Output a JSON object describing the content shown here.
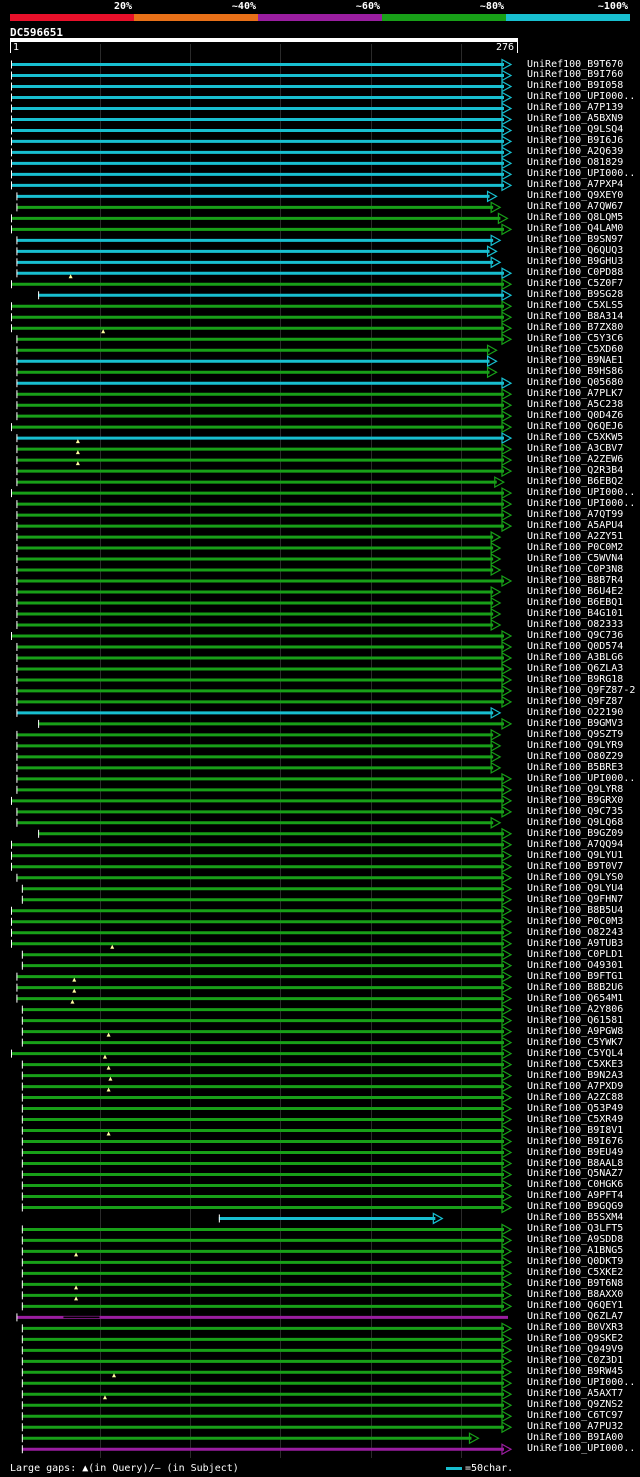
{
  "legend": {
    "labels": [
      "20%",
      "~40%",
      "~60%",
      "~80%",
      "~100%"
    ],
    "colors": [
      "#e8102a",
      "#e87018",
      "#9a1ea0",
      "#18a018",
      "#18bfd0"
    ]
  },
  "query": {
    "id": "DC596651",
    "start": "1",
    "end": "276"
  },
  "footer": {
    "gaps_text": "Large gaps: ▲(in Query)/— (in Subject)",
    "scale_text": "=50char."
  },
  "chart_data": {
    "type": "alignment-map",
    "query_length": 276,
    "identity_bins": [
      "20%",
      "~40%",
      "~60%",
      "~80%",
      "~100%"
    ],
    "hits": [
      {
        "name": "UniRef100_B9T670",
        "start": 1,
        "end": 276,
        "identity": "~100%",
        "arrow": true
      },
      {
        "name": "UniRef100_B9I760",
        "start": 1,
        "end": 276,
        "identity": "~100%",
        "arrow": true
      },
      {
        "name": "UniRef100_B9I058",
        "start": 1,
        "end": 276,
        "identity": "~100%",
        "arrow": true
      },
      {
        "name": "UniRef100_UPI000..",
        "start": 1,
        "end": 276,
        "identity": "~100%",
        "arrow": true
      },
      {
        "name": "UniRef100_A7P139",
        "start": 1,
        "end": 276,
        "identity": "~100%",
        "arrow": true
      },
      {
        "name": "UniRef100_A5BXN9",
        "start": 1,
        "end": 276,
        "identity": "~100%",
        "arrow": true
      },
      {
        "name": "UniRef100_Q9LSQ4",
        "start": 1,
        "end": 276,
        "identity": "~100%",
        "arrow": true
      },
      {
        "name": "UniRef100_B9I6J6",
        "start": 1,
        "end": 276,
        "identity": "~100%",
        "arrow": true
      },
      {
        "name": "UniRef100_A2Q639",
        "start": 1,
        "end": 276,
        "identity": "~100%",
        "arrow": true
      },
      {
        "name": "UniRef100_O81829",
        "start": 1,
        "end": 276,
        "identity": "~100%",
        "arrow": true
      },
      {
        "name": "UniRef100_UPI000..",
        "start": 1,
        "end": 276,
        "identity": "~100%",
        "arrow": true
      },
      {
        "name": "UniRef100_A7PXP4",
        "start": 1,
        "end": 276,
        "identity": "~100%",
        "arrow": true
      },
      {
        "name": "UniRef100_Q9XEY0",
        "start": 4,
        "end": 268,
        "identity": "~100%",
        "arrow": true
      },
      {
        "name": "UniRef100_A7QW67",
        "start": 4,
        "end": 270,
        "identity": "~80%",
        "arrow": true
      },
      {
        "name": "UniRef100_Q8LQM5",
        "start": 1,
        "end": 274,
        "identity": "~80%",
        "arrow": true
      },
      {
        "name": "UniRef100_Q4LAM0",
        "start": 1,
        "end": 276,
        "identity": "~80%",
        "arrow": true
      },
      {
        "name": "UniRef100_B9SN97",
        "start": 4,
        "end": 270,
        "identity": "~100%",
        "arrow": true
      },
      {
        "name": "UniRef100_Q6QUQ3",
        "start": 4,
        "end": 268,
        "identity": "~100%",
        "arrow": true
      },
      {
        "name": "UniRef100_B9GHU3",
        "start": 4,
        "end": 270,
        "identity": "~100%",
        "arrow": true
      },
      {
        "name": "UniRef100_C0PD88",
        "start": 4,
        "end": 276,
        "identity": "~100%",
        "arrow": true
      },
      {
        "name": "UniRef100_C5Z0F7",
        "start": 1,
        "end": 276,
        "identity": "~80%",
        "arrow": true,
        "qgaps": [
          34
        ]
      },
      {
        "name": "UniRef100_B9SG28",
        "start": 16,
        "end": 276,
        "identity": "~100%",
        "arrow": true
      },
      {
        "name": "UniRef100_C5XLS5",
        "start": 1,
        "end": 276,
        "identity": "~80%",
        "arrow": true
      },
      {
        "name": "UniRef100_B8A314",
        "start": 1,
        "end": 276,
        "identity": "~80%",
        "arrow": true
      },
      {
        "name": "UniRef100_B7ZX80",
        "start": 1,
        "end": 276,
        "identity": "~80%",
        "arrow": true
      },
      {
        "name": "UniRef100_C5Y3C6",
        "start": 4,
        "end": 276,
        "identity": "~80%",
        "arrow": true,
        "qgaps": [
          52
        ]
      },
      {
        "name": "UniRef100_C5XD60",
        "start": 4,
        "end": 268,
        "identity": "~80%",
        "arrow": true
      },
      {
        "name": "UniRef100_B9NAE1",
        "start": 4,
        "end": 268,
        "identity": "~100%",
        "arrow": true
      },
      {
        "name": "UniRef100_B9HS86",
        "start": 4,
        "end": 268,
        "identity": "~80%",
        "arrow": true
      },
      {
        "name": "UniRef100_Q05680",
        "start": 4,
        "end": 276,
        "identity": "~100%",
        "arrow": true
      },
      {
        "name": "UniRef100_A7PLK7",
        "start": 4,
        "end": 276,
        "identity": "~80%",
        "arrow": true
      },
      {
        "name": "UniRef100_A5C238",
        "start": 4,
        "end": 276,
        "identity": "~80%",
        "arrow": true
      },
      {
        "name": "UniRef100_Q0D4Z6",
        "start": 4,
        "end": 276,
        "identity": "~80%",
        "arrow": true
      },
      {
        "name": "UniRef100_Q6QEJ6",
        "start": 1,
        "end": 276,
        "identity": "~80%",
        "arrow": true
      },
      {
        "name": "UniRef100_C5XKW5",
        "start": 4,
        "end": 276,
        "identity": "~100%",
        "arrow": true
      },
      {
        "name": "UniRef100_A3CBV7",
        "start": 4,
        "end": 276,
        "identity": "~80%",
        "arrow": true,
        "qgaps": [
          38
        ]
      },
      {
        "name": "UniRef100_A2ZEW6",
        "start": 4,
        "end": 276,
        "identity": "~80%",
        "arrow": true,
        "qgaps": [
          38
        ]
      },
      {
        "name": "UniRef100_Q2R3B4",
        "start": 4,
        "end": 276,
        "identity": "~80%",
        "arrow": true,
        "qgaps": [
          38
        ]
      },
      {
        "name": "UniRef100_B6EBQ2",
        "start": 4,
        "end": 272,
        "identity": "~80%",
        "arrow": true
      },
      {
        "name": "UniRef100_UPI000..",
        "start": 1,
        "end": 276,
        "identity": "~80%",
        "arrow": true
      },
      {
        "name": "UniRef100_UPI000..",
        "start": 4,
        "end": 276,
        "identity": "~80%",
        "arrow": true
      },
      {
        "name": "UniRef100_A7QT99",
        "start": 4,
        "end": 276,
        "identity": "~80%",
        "arrow": true
      },
      {
        "name": "UniRef100_A5APU4",
        "start": 4,
        "end": 276,
        "identity": "~80%",
        "arrow": true
      },
      {
        "name": "UniRef100_A2ZY51",
        "start": 4,
        "end": 270,
        "identity": "~80%",
        "arrow": true
      },
      {
        "name": "UniRef100_P0C0M2",
        "start": 4,
        "end": 270,
        "identity": "~80%",
        "arrow": true
      },
      {
        "name": "UniRef100_C5WVN4",
        "start": 4,
        "end": 270,
        "identity": "~80%",
        "arrow": true
      },
      {
        "name": "UniRef100_C0P3N8",
        "start": 4,
        "end": 270,
        "identity": "~80%",
        "arrow": true
      },
      {
        "name": "UniRef100_B8B7R4",
        "start": 4,
        "end": 276,
        "identity": "~80%",
        "arrow": true
      },
      {
        "name": "UniRef100_B6U4E2",
        "start": 4,
        "end": 270,
        "identity": "~80%",
        "arrow": true
      },
      {
        "name": "UniRef100_B6EBQ1",
        "start": 4,
        "end": 270,
        "identity": "~80%",
        "arrow": true
      },
      {
        "name": "UniRef100_B4G101",
        "start": 4,
        "end": 270,
        "identity": "~80%",
        "arrow": true
      },
      {
        "name": "UniRef100_O82333",
        "start": 4,
        "end": 270,
        "identity": "~80%",
        "arrow": true
      },
      {
        "name": "UniRef100_Q9C736",
        "start": 1,
        "end": 276,
        "identity": "~80%",
        "arrow": true
      },
      {
        "name": "UniRef100_Q0D574",
        "start": 4,
        "end": 276,
        "identity": "~80%",
        "arrow": true
      },
      {
        "name": "UniRef100_A3BLG6",
        "start": 4,
        "end": 276,
        "identity": "~80%",
        "arrow": true
      },
      {
        "name": "UniRef100_Q6ZLA3",
        "start": 4,
        "end": 276,
        "identity": "~80%",
        "arrow": true
      },
      {
        "name": "UniRef100_B9RG18",
        "start": 4,
        "end": 276,
        "identity": "~80%",
        "arrow": true
      },
      {
        "name": "UniRef100_Q9FZ87-2",
        "start": 4,
        "end": 276,
        "identity": "~80%",
        "arrow": true
      },
      {
        "name": "UniRef100_Q9FZ87",
        "start": 4,
        "end": 276,
        "identity": "~80%",
        "arrow": true
      },
      {
        "name": "UniRef100_O22190",
        "start": 4,
        "end": 270,
        "identity": "~100%",
        "arrow": true
      },
      {
        "name": "UniRef100_B9GMV3",
        "start": 16,
        "end": 276,
        "identity": "~80%",
        "arrow": true
      },
      {
        "name": "UniRef100_Q9SZT9",
        "start": 4,
        "end": 270,
        "identity": "~80%",
        "arrow": true
      },
      {
        "name": "UniRef100_Q9LYR9",
        "start": 4,
        "end": 270,
        "identity": "~80%",
        "arrow": true
      },
      {
        "name": "UniRef100_O80Z29",
        "start": 4,
        "end": 270,
        "identity": "~80%",
        "arrow": true
      },
      {
        "name": "UniRef100_B5BRE3",
        "start": 4,
        "end": 270,
        "identity": "~80%",
        "arrow": true
      },
      {
        "name": "UniRef100_UPI000..",
        "start": 4,
        "end": 276,
        "identity": "~80%",
        "arrow": true
      },
      {
        "name": "UniRef100_Q9LYR8",
        "start": 4,
        "end": 276,
        "identity": "~80%",
        "arrow": true
      },
      {
        "name": "UniRef100_B9GRX0",
        "start": 1,
        "end": 276,
        "identity": "~80%",
        "arrow": true
      },
      {
        "name": "UniRef100_Q9C735",
        "start": 4,
        "end": 276,
        "identity": "~80%",
        "arrow": true
      },
      {
        "name": "UniRef100_Q9LQ68",
        "start": 4,
        "end": 270,
        "identity": "~80%",
        "arrow": true
      },
      {
        "name": "UniRef100_B9GZ09",
        "start": 16,
        "end": 276,
        "identity": "~80%",
        "arrow": true
      },
      {
        "name": "UniRef100_A7QQ94",
        "start": 1,
        "end": 276,
        "identity": "~80%",
        "arrow": true
      },
      {
        "name": "UniRef100_Q9LYU1",
        "start": 1,
        "end": 276,
        "identity": "~80%",
        "arrow": true
      },
      {
        "name": "UniRef100_B9T0V7",
        "start": 1,
        "end": 276,
        "identity": "~80%",
        "arrow": true
      },
      {
        "name": "UniRef100_Q9LYS0",
        "start": 4,
        "end": 276,
        "identity": "~80%",
        "arrow": true
      },
      {
        "name": "UniRef100_Q9LYU4",
        "start": 7,
        "end": 276,
        "identity": "~80%",
        "arrow": true
      },
      {
        "name": "UniRef100_Q9FHN7",
        "start": 7,
        "end": 276,
        "identity": "~80%",
        "arrow": true
      },
      {
        "name": "UniRef100_B8B5U4",
        "start": 1,
        "end": 276,
        "identity": "~80%",
        "arrow": true
      },
      {
        "name": "UniRef100_P0C0M3",
        "start": 1,
        "end": 276,
        "identity": "~80%",
        "arrow": true
      },
      {
        "name": "UniRef100_O82243",
        "start": 1,
        "end": 276,
        "identity": "~80%",
        "arrow": true
      },
      {
        "name": "UniRef100_A9TUB3",
        "start": 1,
        "end": 276,
        "identity": "~80%",
        "arrow": true
      },
      {
        "name": "UniRef100_C0PLD1",
        "start": 7,
        "end": 276,
        "identity": "~80%",
        "arrow": true,
        "qgaps": [
          57
        ]
      },
      {
        "name": "UniRef100_O49301",
        "start": 7,
        "end": 276,
        "identity": "~80%",
        "arrow": true
      },
      {
        "name": "UniRef100_B9FTG1",
        "start": 4,
        "end": 276,
        "identity": "~80%",
        "arrow": true
      },
      {
        "name": "UniRef100_B8B2U6",
        "start": 4,
        "end": 276,
        "identity": "~80%",
        "arrow": true,
        "qgaps": [
          36
        ]
      },
      {
        "name": "UniRef100_Q654M1",
        "start": 4,
        "end": 276,
        "identity": "~80%",
        "arrow": true,
        "qgaps": [
          36
        ]
      },
      {
        "name": "UniRef100_A2Y806",
        "start": 7,
        "end": 276,
        "identity": "~80%",
        "arrow": true,
        "qgaps": [
          35
        ]
      },
      {
        "name": "UniRef100_Q61581",
        "start": 7,
        "end": 276,
        "identity": "~80%",
        "arrow": true
      },
      {
        "name": "UniRef100_A9PGW8",
        "start": 7,
        "end": 276,
        "identity": "~80%",
        "arrow": true
      },
      {
        "name": "UniRef100_C5YWK7",
        "start": 7,
        "end": 276,
        "identity": "~80%",
        "arrow": true,
        "qgaps": [
          55
        ]
      },
      {
        "name": "UniRef100_C5YQL4",
        "start": 1,
        "end": 276,
        "identity": "~80%",
        "arrow": true
      },
      {
        "name": "UniRef100_C5XKE3",
        "start": 7,
        "end": 276,
        "identity": "~80%",
        "arrow": true,
        "qgaps": [
          53
        ]
      },
      {
        "name": "UniRef100_B9N2A3",
        "start": 7,
        "end": 276,
        "identity": "~80%",
        "arrow": true,
        "qgaps": [
          55
        ]
      },
      {
        "name": "UniRef100_A7PXD9",
        "start": 7,
        "end": 276,
        "identity": "~80%",
        "arrow": true,
        "qgaps": [
          56
        ]
      },
      {
        "name": "UniRef100_A2ZC88",
        "start": 7,
        "end": 276,
        "identity": "~80%",
        "arrow": true,
        "qgaps": [
          55
        ]
      },
      {
        "name": "UniRef100_Q53P49",
        "start": 7,
        "end": 276,
        "identity": "~80%",
        "arrow": true
      },
      {
        "name": "UniRef100_C5XR49",
        "start": 7,
        "end": 276,
        "identity": "~80%",
        "arrow": true
      },
      {
        "name": "UniRef100_B9I8V1",
        "start": 7,
        "end": 276,
        "identity": "~80%",
        "arrow": true
      },
      {
        "name": "UniRef100_B9I676",
        "start": 7,
        "end": 276,
        "identity": "~80%",
        "arrow": true,
        "qgaps": [
          55
        ]
      },
      {
        "name": "UniRef100_B9EU49",
        "start": 7,
        "end": 276,
        "identity": "~80%",
        "arrow": true
      },
      {
        "name": "UniRef100_B8AAL8",
        "start": 7,
        "end": 276,
        "identity": "~80%",
        "arrow": true
      },
      {
        "name": "UniRef100_Q5NAZ7",
        "start": 7,
        "end": 276,
        "identity": "~80%",
        "arrow": true
      },
      {
        "name": "UniRef100_C0HGK6",
        "start": 7,
        "end": 276,
        "identity": "~80%",
        "arrow": true
      },
      {
        "name": "UniRef100_A9PFT4",
        "start": 7,
        "end": 276,
        "identity": "~80%",
        "arrow": true
      },
      {
        "name": "UniRef100_B9GQG9",
        "start": 7,
        "end": 276,
        "identity": "~80%",
        "arrow": true
      },
      {
        "name": "UniRef100_B5SXM4",
        "start": 116,
        "end": 238,
        "identity": "~100%",
        "arrow": true
      },
      {
        "name": "UniRef100_Q3LFT5",
        "start": 7,
        "end": 276,
        "identity": "~80%",
        "arrow": true
      },
      {
        "name": "UniRef100_A9SDD8",
        "start": 7,
        "end": 276,
        "identity": "~80%",
        "arrow": true
      },
      {
        "name": "UniRef100_A1BNG5",
        "start": 7,
        "end": 276,
        "identity": "~80%",
        "arrow": true
      },
      {
        "name": "UniRef100_Q0DKT9",
        "start": 7,
        "end": 276,
        "identity": "~80%",
        "arrow": true,
        "qgaps": [
          37
        ]
      },
      {
        "name": "UniRef100_C5XKE2",
        "start": 7,
        "end": 276,
        "identity": "~80%",
        "arrow": true
      },
      {
        "name": "UniRef100_B9T6N8",
        "start": 7,
        "end": 276,
        "identity": "~80%",
        "arrow": true
      },
      {
        "name": "UniRef100_B8AXX0",
        "start": 7,
        "end": 276,
        "identity": "~80%",
        "arrow": true,
        "qgaps": [
          37
        ]
      },
      {
        "name": "UniRef100_Q6QEY1",
        "start": 7,
        "end": 276,
        "identity": "~80%",
        "arrow": true,
        "qgaps": [
          37
        ]
      },
      {
        "name": "UniRef100_Q6ZLA7",
        "start": 4,
        "end": 276,
        "identity": "~60%",
        "arrow": false,
        "sgaps": [
          [
            30,
            50
          ]
        ]
      },
      {
        "name": "UniRef100_B0VXR3",
        "start": 7,
        "end": 276,
        "identity": "~80%",
        "arrow": true
      },
      {
        "name": "UniRef100_Q9SKE2",
        "start": 7,
        "end": 276,
        "identity": "~80%",
        "arrow": true
      },
      {
        "name": "UniRef100_Q949V9",
        "start": 7,
        "end": 276,
        "identity": "~80%",
        "arrow": true
      },
      {
        "name": "UniRef100_C0Z3D1",
        "start": 7,
        "end": 276,
        "identity": "~80%",
        "arrow": true
      },
      {
        "name": "UniRef100_B9RW45",
        "start": 7,
        "end": 276,
        "identity": "~80%",
        "arrow": true
      },
      {
        "name": "UniRef100_UPI000..",
        "start": 7,
        "end": 276,
        "identity": "~80%",
        "arrow": true,
        "qgaps": [
          58
        ]
      },
      {
        "name": "UniRef100_A5AXT7",
        "start": 7,
        "end": 276,
        "identity": "~80%",
        "arrow": true
      },
      {
        "name": "UniRef100_Q9ZNS2",
        "start": 7,
        "end": 276,
        "identity": "~80%",
        "arrow": true,
        "qgaps": [
          53
        ]
      },
      {
        "name": "UniRef100_C6TC97",
        "start": 7,
        "end": 276,
        "identity": "~80%",
        "arrow": true
      },
      {
        "name": "UniRef100_A7PU32",
        "start": 7,
        "end": 276,
        "identity": "~80%",
        "arrow": true
      },
      {
        "name": "UniRef100_B9IA00",
        "start": 7,
        "end": 258,
        "identity": "~80%",
        "arrow": true
      },
      {
        "name": "UniRef100_UPI000..",
        "start": 7,
        "end": 276,
        "identity": "~60%",
        "arrow": true
      }
    ]
  }
}
